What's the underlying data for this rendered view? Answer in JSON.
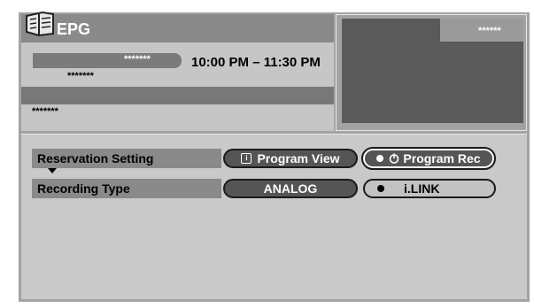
{
  "header": {
    "title": "EPG"
  },
  "program": {
    "channel": "*******",
    "name": "*******",
    "time": "10:00 PM – 11:30 PM",
    "description": "*******"
  },
  "preview": {
    "label": "******"
  },
  "reservation": {
    "label": "Reservation Setting",
    "options": [
      "Program View",
      "Program Rec"
    ],
    "selected": "Program Rec"
  },
  "recording": {
    "label": "Recording Type",
    "options": [
      "ANALOG",
      "i.LINK"
    ],
    "selected": "i.LINK"
  },
  "colors": {
    "background": "#a3a3a3",
    "panel": "#c6c6c6",
    "highlight": "#555555"
  }
}
